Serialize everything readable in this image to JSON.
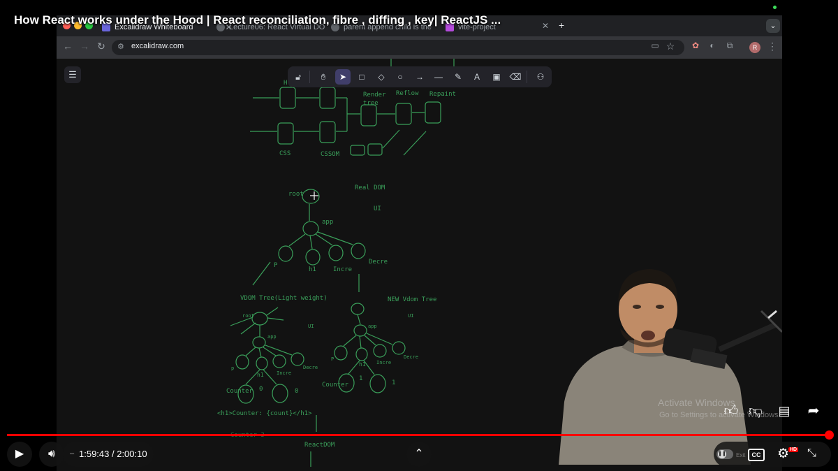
{
  "video": {
    "title": "How React works under the Hood | React reconciliation, fibre , diffing , key| ReactJS ...",
    "time": "1:59:43 / 2:00:10",
    "progress": 0.9978
  },
  "browser": {
    "tabs": [
      {
        "label": "Excalidraw Whiteboard",
        "color": "#6965db"
      },
      {
        "label": "Lecture06: React Virtual DO",
        "color": "#9aa0a6"
      },
      {
        "label": "parent append child is the",
        "color": "#9aa0a6"
      },
      {
        "label": "vite-project",
        "color": "#b44bdc"
      }
    ],
    "url": "excalidraw.com",
    "profile_initial": "R"
  },
  "excalidraw": {
    "menu_icon": "hamburger-icon",
    "tools": [
      "lock-icon",
      "hand-icon",
      "pointer-icon",
      "rectangle-icon",
      "diamond-icon",
      "ellipse-icon",
      "arrow-icon",
      "line-icon",
      "pencil-icon",
      "text-icon",
      "image-icon",
      "eraser-icon",
      "library-icon"
    ]
  },
  "drawing": {
    "labels": {
      "h": "H",
      "render_tree": "Render\ntree",
      "reflow": "Reflow",
      "repaint": "Repaint",
      "css": "CSS",
      "cssom": "CSSOM",
      "root": "root",
      "real_dom": "Real DOM",
      "ui1": "UI",
      "app1": "app",
      "p1": "P",
      "h1_1": "h1",
      "incre1": "Incre",
      "decre1": "Decre",
      "vdom_tree": "VDOM Tree(Light weight)",
      "new_vdom_tree": "NEW Vdom Tree",
      "root2": "root",
      "ui2": "UI",
      "app2": "app",
      "p2": "p",
      "h1_2": "h1",
      "incre2": "Incre",
      "decre2": "Decre",
      "counter1": "Counter",
      "zero1": "0",
      "zero2": "0",
      "ui3": "UI",
      "app3": "app",
      "p3": "P",
      "h1_3": "h1",
      "incre3": "Incre",
      "decre3": "Decre",
      "counter2": "Counter",
      "one1": "1",
      "one2": "1",
      "h1_code": "<h1>Counter: {count}</h1>",
      "counter_3": "Counter 3",
      "reactdom": "ReactDOM"
    }
  },
  "overlay": {
    "activate_windows": "Activate Windows",
    "activate_sub": "Go to Settings to activate Windows.",
    "exit_label": "Exit"
  },
  "colors": {
    "drawing_green": "#3a9f5a",
    "progress_red": "#ff0000",
    "excalidraw_accent": "#403e6a"
  }
}
